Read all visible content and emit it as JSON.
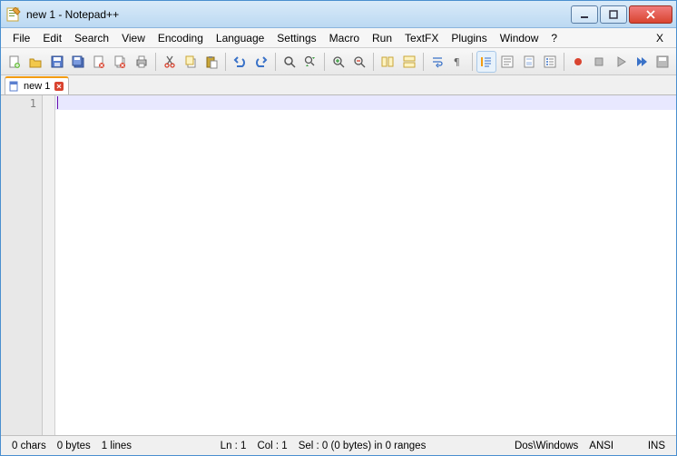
{
  "window": {
    "title": "new  1 - Notepad++"
  },
  "menu": {
    "items": [
      "File",
      "Edit",
      "Search",
      "View",
      "Encoding",
      "Language",
      "Settings",
      "Macro",
      "Run",
      "TextFX",
      "Plugins",
      "Window",
      "?"
    ],
    "close_label": "X"
  },
  "toolbar_icons": [
    "new-file-icon",
    "open-file-icon",
    "save-icon",
    "save-all-icon",
    "close-icon",
    "close-all-icon",
    "print-icon",
    "sep",
    "cut-icon",
    "copy-icon",
    "paste-icon",
    "sep",
    "undo-icon",
    "redo-icon",
    "sep",
    "find-icon",
    "replace-icon",
    "sep",
    "zoom-in-icon",
    "zoom-out-icon",
    "sep",
    "sync-v-icon",
    "sync-h-icon",
    "sep",
    "wrap-icon",
    "show-all-icon",
    "sep",
    "indent-guide-icon",
    "udl-icon",
    "doc-map-icon",
    "func-list-icon",
    "sep",
    "macro-record-icon",
    "macro-stop-icon",
    "macro-play-icon",
    "macro-play-multi-icon",
    "macro-save-icon"
  ],
  "tabs": [
    {
      "label": "new  1",
      "active": true
    }
  ],
  "editor": {
    "line_numbers": [
      "1"
    ]
  },
  "status": {
    "chars": "0 chars",
    "bytes": "0 bytes",
    "lines": "1 lines",
    "ln": "Ln : 1",
    "col": "Col : 1",
    "sel": "Sel : 0 (0 bytes) in 0 ranges",
    "eol": "Dos\\Windows",
    "encoding": "ANSI",
    "mode": "INS"
  }
}
